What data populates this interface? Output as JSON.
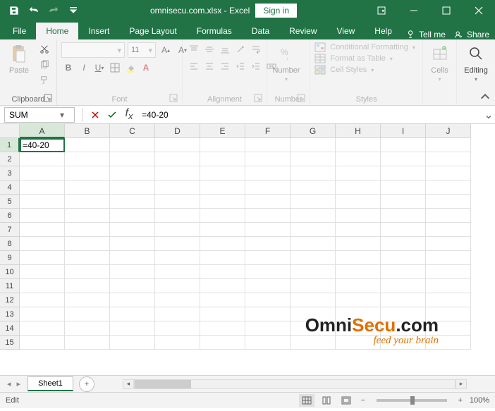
{
  "titlebar": {
    "title": "omnisecu.com.xlsx - Excel",
    "signin": "Sign in"
  },
  "tabs": {
    "file": "File",
    "home": "Home",
    "insert": "Insert",
    "pagelayout": "Page Layout",
    "formulas": "Formulas",
    "data": "Data",
    "review": "Review",
    "view": "View",
    "help": "Help",
    "tellme": "Tell me",
    "share": "Share"
  },
  "ribbon": {
    "clipboard": {
      "label": "Clipboard",
      "paste": "Paste"
    },
    "font": {
      "label": "Font",
      "name": "",
      "size": "11"
    },
    "alignment": {
      "label": "Alignment"
    },
    "number": {
      "label": "Number",
      "btn": "Number"
    },
    "styles": {
      "label": "Styles",
      "conditional": "Conditional Formatting",
      "table": "Format as Table",
      "cell": "Cell Styles"
    },
    "cells": {
      "label": "Cells"
    },
    "editing": {
      "label": "Editing"
    }
  },
  "formulabar": {
    "namebox": "SUM",
    "formula": "=40-20"
  },
  "grid": {
    "columns": [
      "A",
      "B",
      "C",
      "D",
      "E",
      "F",
      "G",
      "H",
      "I",
      "J"
    ],
    "rows": [
      "1",
      "2",
      "3",
      "4",
      "5",
      "6",
      "7",
      "8",
      "9",
      "10",
      "11",
      "12",
      "13",
      "14",
      "15"
    ],
    "editing_cell": "=40-20"
  },
  "sheet": {
    "tab": "Sheet1"
  },
  "status": {
    "mode": "Edit",
    "zoom": "100%"
  },
  "watermark": {
    "line1a": "Omni",
    "line1b": "Secu",
    "line1c": ".com",
    "line2": "feed your brain"
  }
}
